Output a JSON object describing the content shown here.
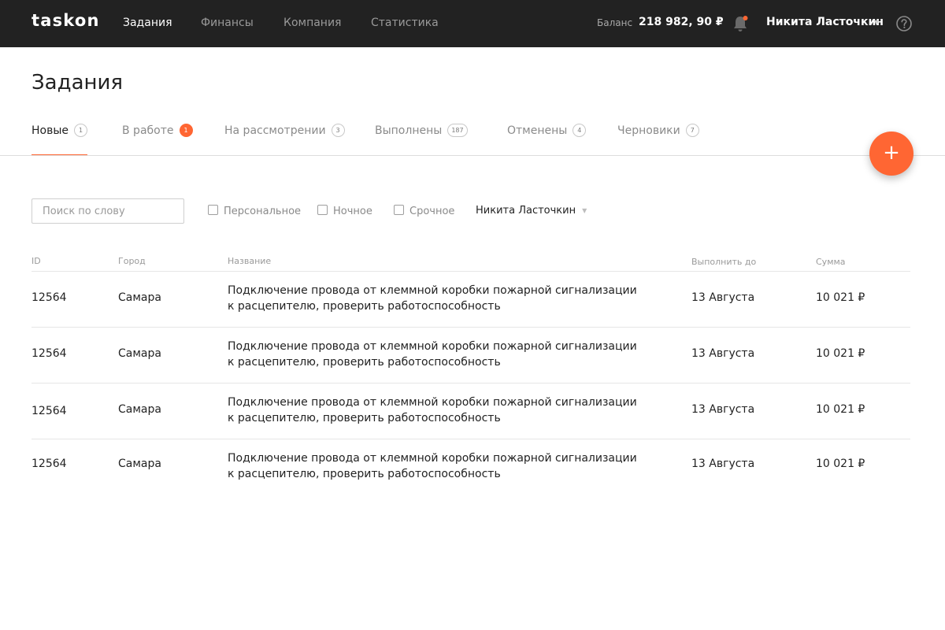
{
  "app": {
    "logo": "taskon",
    "accent_color": "#ff6633",
    "topbar_color": "#222222"
  },
  "nav": {
    "items": [
      {
        "label": "Задания",
        "active": true
      },
      {
        "label": "Финансы",
        "active": false
      },
      {
        "label": "Компания",
        "active": false
      },
      {
        "label": "Статистика",
        "active": false
      }
    ]
  },
  "header": {
    "balance_label": "Баланс",
    "balance_value": "218 982, 90 ₽",
    "notification_icon": "bell-icon",
    "has_unread": true,
    "user_name": "Никита Ласточкин",
    "help_icon": "question-circle-icon"
  },
  "page": {
    "title": "Задания"
  },
  "tabs": [
    {
      "label": "Новые",
      "count": "1",
      "active": true,
      "highlight": false
    },
    {
      "label": "В работе",
      "count": "1",
      "active": false,
      "highlight": true
    },
    {
      "label": "На рассмотрении",
      "count": "3",
      "active": false,
      "highlight": false
    },
    {
      "label": "Выполнены",
      "count": "187",
      "active": false,
      "highlight": false
    },
    {
      "label": "Отменены",
      "count": "4",
      "active": false,
      "highlight": false
    },
    {
      "label": "Черновики",
      "count": "7",
      "active": false,
      "highlight": false
    }
  ],
  "fab": {
    "label": "+"
  },
  "filters": {
    "search_placeholder": "Поиск по слову",
    "checkboxes": [
      {
        "label": "Персональное",
        "checked": false
      },
      {
        "label": "Ночное",
        "checked": false
      },
      {
        "label": "Срочное",
        "checked": false
      }
    ],
    "assignee": "Никита Ласточкин"
  },
  "table": {
    "columns": [
      "ID",
      "Город",
      "Название",
      "Выполнить до",
      "Сумма"
    ],
    "rows": [
      {
        "id": "12564",
        "city": "Самара",
        "title_line1": "Подключение провода от клеммной коробки пожарной сигнализации",
        "title_line2": "к расцепителю, проверить работоспособность",
        "due": "13 Августа",
        "sum": "10 021 ₽"
      },
      {
        "id": "12564",
        "city": "Самара",
        "title_line1": "Подключение провода от клеммной коробки пожарной сигнализации",
        "title_line2": "к расцепителю, проверить работоспособность",
        "due": "13 Августа",
        "sum": "10 021 ₽"
      },
      {
        "id": "12564",
        "city": "Самара",
        "title_line1": "Подключение провода от клеммной коробки пожарной сигнализации",
        "title_line2": "к расцепителю, проверить работоспособность",
        "due": "13 Августа",
        "sum": "10 021 ₽"
      },
      {
        "id": "12564",
        "city": "Самара",
        "title_line1": "Подключение провода от клеммной коробки пожарной сигнализации",
        "title_line2": "к расцепителю, проверить работоспособность",
        "due": "13 Августа",
        "sum": "10 021 ₽"
      }
    ]
  }
}
